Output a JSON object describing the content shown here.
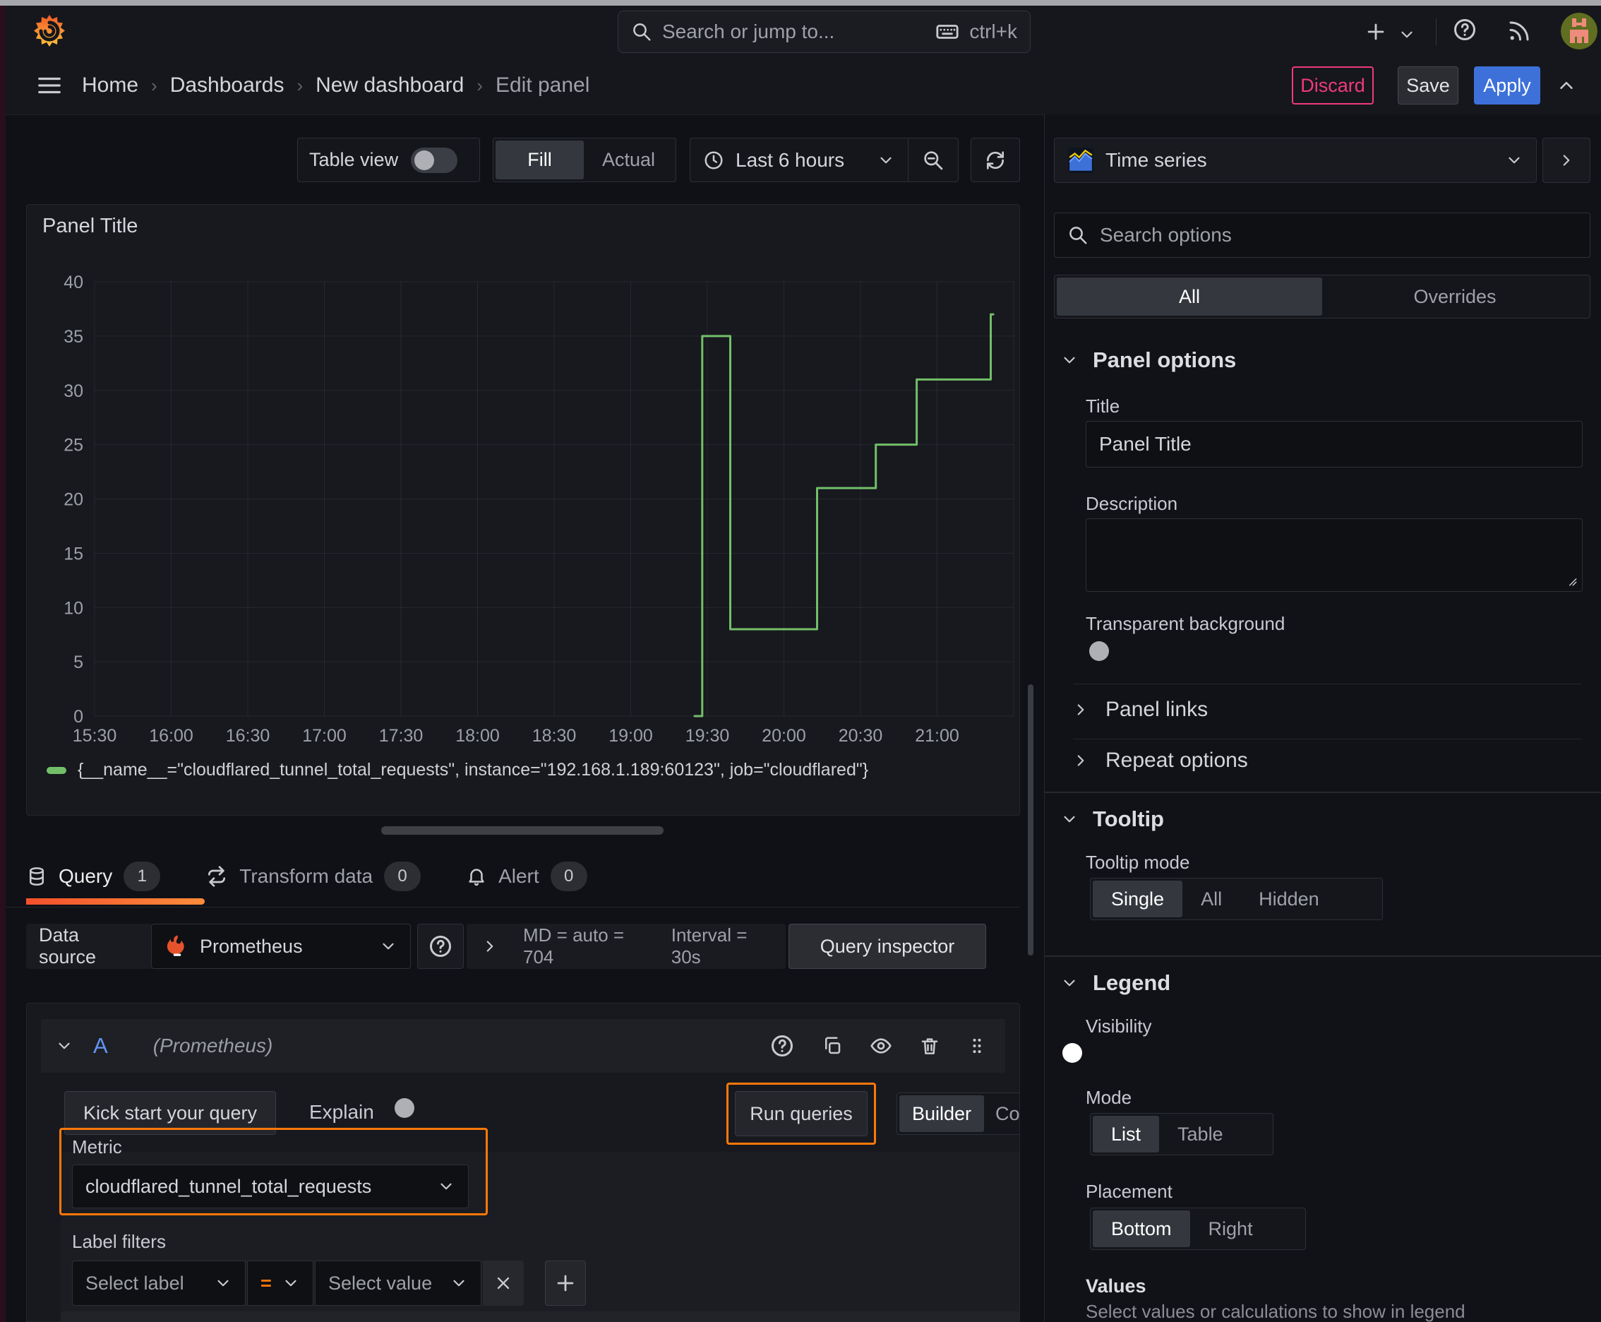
{
  "topnav": {
    "search_placeholder": "Search or jump to...",
    "search_shortcut": "ctrl+k"
  },
  "breadcrumb": {
    "items": [
      "Home",
      "Dashboards",
      "New dashboard"
    ],
    "current": "Edit panel",
    "discard_label": "Discard",
    "save_label": "Save",
    "apply_label": "Apply"
  },
  "toolbar": {
    "table_view_label": "Table view",
    "fill_label": "Fill",
    "actual_label": "Actual",
    "time_range_label": "Last 6 hours"
  },
  "panel": {
    "title": "Panel Title"
  },
  "chart_data": {
    "type": "line",
    "subtype": "step-after",
    "title": "Panel Title",
    "xlabel": "",
    "ylabel": "",
    "x_ticks": [
      "15:30",
      "16:00",
      "16:30",
      "17:00",
      "17:30",
      "18:00",
      "18:30",
      "19:00",
      "19:30",
      "20:00",
      "20:30",
      "21:00"
    ],
    "x_range": [
      "15:30",
      "21:30"
    ],
    "y_ticks": [
      0,
      5,
      10,
      15,
      20,
      25,
      30,
      35,
      40
    ],
    "ylim": [
      0,
      40
    ],
    "grid": true,
    "legend_position": "bottom",
    "series": [
      {
        "name": "{__name__=\"cloudflared_tunnel_total_requests\", instance=\"192.168.1.189:60123\", job=\"cloudflared\"}",
        "color": "#73bf69",
        "points": [
          [
            "19:25",
            0
          ],
          [
            "19:28",
            0
          ],
          [
            "19:28",
            35
          ],
          [
            "19:39",
            35
          ],
          [
            "19:39",
            8
          ],
          [
            "20:13",
            8
          ],
          [
            "20:13",
            21
          ],
          [
            "20:36",
            21
          ],
          [
            "20:36",
            25
          ],
          [
            "20:52",
            25
          ],
          [
            "20:52",
            31
          ],
          [
            "21:21",
            31
          ],
          [
            "21:21",
            37
          ],
          [
            "21:22",
            37
          ]
        ]
      }
    ]
  },
  "tabs": [
    {
      "label": "Query",
      "count": "1",
      "active": true
    },
    {
      "label": "Transform data",
      "count": "0",
      "active": false
    },
    {
      "label": "Alert",
      "count": "0",
      "active": false
    }
  ],
  "datasource": {
    "label": "Data source",
    "name": "Prometheus",
    "max_data_points": "MD = auto = 704",
    "interval": "Interval = 30s",
    "inspector_label": "Query inspector"
  },
  "query": {
    "ref_id": "A",
    "ds_hint": "(Prometheus)",
    "kick_start_label": "Kick start your query",
    "explain_label": "Explain",
    "run_label": "Run queries",
    "builder_label": "Builder",
    "code_label": "Code",
    "metric_label": "Metric",
    "metric_value": "cloudflared_tunnel_total_requests",
    "label_filters_label": "Label filters",
    "select_label_placeholder": "Select label",
    "operator": "=",
    "select_value_placeholder": "Select value",
    "remove_label": "x"
  },
  "sidebar": {
    "viz_name": "Time series",
    "search_placeholder": "Search options",
    "tab_all": "All",
    "tab_overrides": "Overrides",
    "panel_options": {
      "title": "Panel options",
      "title_label": "Title",
      "title_value": "Panel Title",
      "description_label": "Description",
      "transparent_label": "Transparent background"
    },
    "links_label": "Panel links",
    "repeat_label": "Repeat options",
    "tooltip": {
      "title": "Tooltip",
      "mode_label": "Tooltip mode",
      "options": [
        "Single",
        "All",
        "Hidden"
      ],
      "selected": "Single"
    },
    "legend": {
      "title": "Legend",
      "visibility_label": "Visibility",
      "mode_label": "Mode",
      "mode_options": [
        "List",
        "Table"
      ],
      "mode_selected": "List",
      "placement_label": "Placement",
      "placement_options": [
        "Bottom",
        "Right"
      ],
      "placement_selected": "Bottom",
      "values_label": "Values",
      "values_hint": "Select values or calculations to show in legend"
    }
  },
  "colors": {
    "accent_orange": "#ff780a",
    "series_green": "#73bf69",
    "primary_blue": "#3d71d9",
    "discard_pink": "#ef3a7c"
  }
}
